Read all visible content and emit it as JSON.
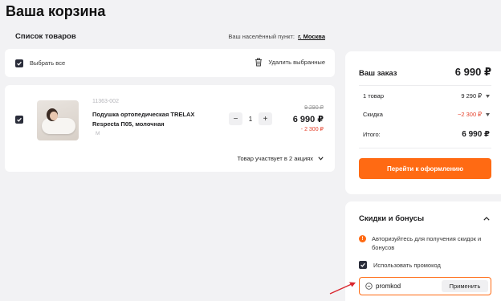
{
  "page": {
    "title": "Ваша корзина"
  },
  "list": {
    "title": "Список товаров",
    "locality_label": "Ваш населённый пункт:",
    "locality_value": "г. Москва",
    "select_all_label": "Выбрать все",
    "delete_selected_label": "Удалить выбранные"
  },
  "item": {
    "sku": "11363-002",
    "name": "Подушка ортопедическая TRELAX Respecta П05, молочная",
    "size_badge": "M",
    "quantity": "1",
    "minus": "−",
    "plus": "+",
    "old_price": "9 290 ₽",
    "price": "6 990 ₽",
    "discount": "- 2 300 ₽",
    "promos_label": "Товар участвует в 2 акциях",
    "selected": true
  },
  "order": {
    "title": "Ваш заказ",
    "total": "6 990 ₽",
    "rows": [
      {
        "label": "1 товар",
        "value": "9 290 ₽"
      },
      {
        "label": "Скидка",
        "value": "−2 300 ₽"
      },
      {
        "label": "Итого:",
        "value": "6 990 ₽"
      }
    ],
    "checkout_label": "Перейти к оформлению"
  },
  "bonus": {
    "title": "Скидки и бонусы",
    "auth_text": "Авторизуйтесь для получения скидок и бонусов",
    "use_promo_label": "Использовать промокод",
    "promo_value": "promkod",
    "apply_label": "Применить"
  },
  "colors": {
    "accent": "#ff6a13",
    "discount": "#e5412b",
    "checkbox": "#2a2d3a",
    "annotation": "#d9262e"
  },
  "icons": [
    "check-icon",
    "trash-icon",
    "chevron-down-icon",
    "chevron-up-icon",
    "info-icon",
    "promo-icon"
  ]
}
